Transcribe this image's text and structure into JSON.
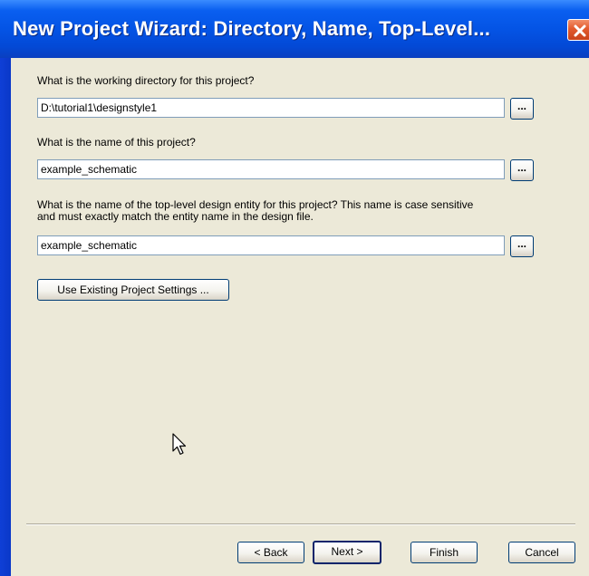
{
  "window": {
    "title": "New Project Wizard: Directory, Name, Top-Level..."
  },
  "directory": {
    "prompt": "What is the working directory for this project?",
    "value": "D:\\tutorial1\\designstyle1",
    "browse_label": "..."
  },
  "project_name": {
    "prompt": "What is the name of this project?",
    "value": "example_schematic",
    "browse_label": "..."
  },
  "top_level": {
    "prompt_line1": "What is the name of the top-level design entity for this project? This name is case sensitive",
    "prompt_line2": "and must exactly match the entity name in the design file.",
    "value": "example_schematic",
    "browse_label": "..."
  },
  "use_existing_label": "Use Existing Project Settings ...",
  "footer": {
    "back_label": "< Back",
    "next_label": "Next >",
    "finish_label": "Finish",
    "cancel_label": "Cancel"
  },
  "colors": {
    "titlebar": "#0454e5",
    "dialog_bg": "#ece9d8",
    "close_button": "#e25a2e"
  },
  "icons": {
    "close": "close-icon",
    "cursor": "mouse-pointer-icon"
  }
}
